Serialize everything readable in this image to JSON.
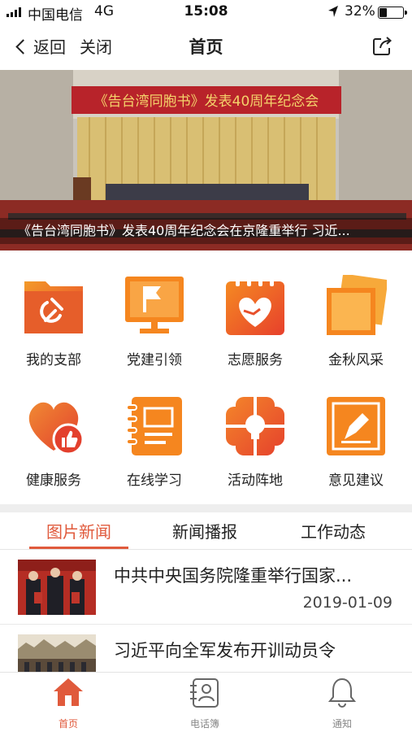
{
  "status_bar": {
    "carrier": "中国电信",
    "network": "4G",
    "time": "15:08",
    "battery_percent": "32%",
    "battery_level": 0.32
  },
  "nav": {
    "back_label": "返回",
    "close_label": "关闭",
    "title": "首页"
  },
  "banner": {
    "headline": "《告台湾同胞书》发表40周年纪念会",
    "caption": "《告台湾同胞书》发表40周年纪念会在京隆重举行 习近..."
  },
  "grid": {
    "items": [
      {
        "label": "我的支部",
        "icon": "party-folder-icon"
      },
      {
        "label": "党建引领",
        "icon": "flag-monitor-icon"
      },
      {
        "label": "志愿服务",
        "icon": "heart-hand-calendar-icon"
      },
      {
        "label": "金秋风采",
        "icon": "photo-frames-icon"
      },
      {
        "label": "健康服务",
        "icon": "heart-thumbs-up-icon"
      },
      {
        "label": "在线学习",
        "icon": "notebook-icon"
      },
      {
        "label": "活动阵地",
        "icon": "flower-bulb-icon"
      },
      {
        "label": "意见建议",
        "icon": "pen-note-icon"
      }
    ]
  },
  "tabs": {
    "items": [
      "图片新闻",
      "新闻播报",
      "工作动态"
    ],
    "active_index": 0
  },
  "news": {
    "items": [
      {
        "title": "中共中央国务院隆重举行国家...",
        "date": "2019-01-09"
      },
      {
        "title": "习近平向全军发布开训动员令",
        "date": ""
      }
    ]
  },
  "tabbar": {
    "items": [
      {
        "label": "首页",
        "icon": "home-icon"
      },
      {
        "label": "电话簿",
        "icon": "contacts-icon"
      },
      {
        "label": "通知",
        "icon": "bell-icon"
      }
    ]
  },
  "colors": {
    "accent": "#e05a3c",
    "icon_orange": "#f5861f",
    "icon_red": "#e8412c"
  }
}
